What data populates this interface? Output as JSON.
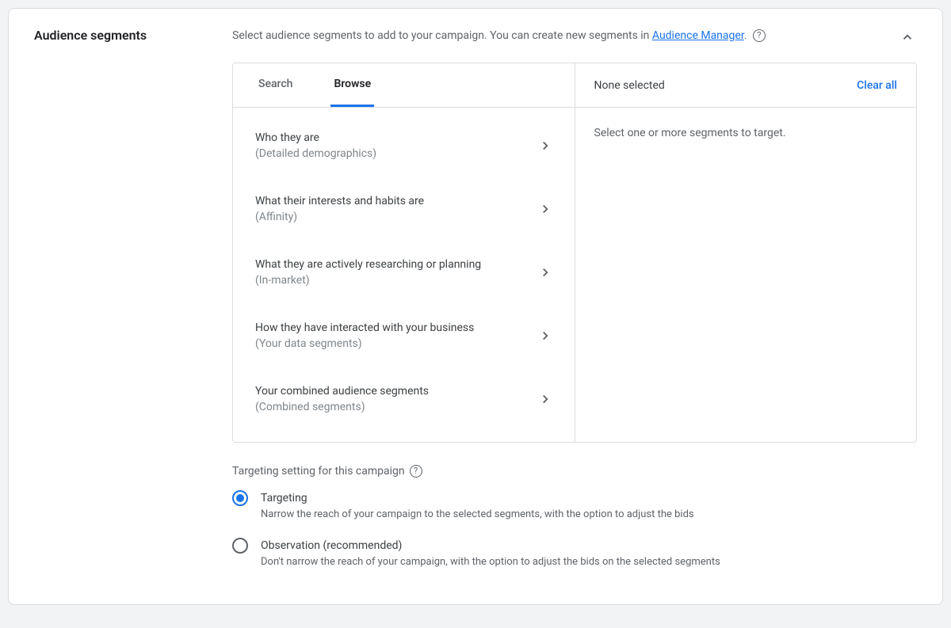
{
  "header": {
    "title": "Audience segments",
    "desc_prefix": "Select audience segments to add to your campaign. You can create new segments in ",
    "desc_link": "Audience Manager",
    "desc_suffix": "."
  },
  "tabs": {
    "search": "Search",
    "browse": "Browse"
  },
  "categories": [
    {
      "title": "Who they are",
      "subtitle": "(Detailed demographics)"
    },
    {
      "title": "What their interests and habits are",
      "subtitle": "(Affinity)"
    },
    {
      "title": "What they are actively researching or planning",
      "subtitle": "(In-market)"
    },
    {
      "title": "How they have interacted with your business",
      "subtitle": "(Your data segments)"
    },
    {
      "title": "Your combined audience segments",
      "subtitle": "(Combined segments)"
    }
  ],
  "right": {
    "title": "None selected",
    "clear": "Clear all",
    "empty": "Select one or more segments to target."
  },
  "targeting": {
    "heading": "Targeting setting for this campaign",
    "options": [
      {
        "title": "Targeting",
        "desc": "Narrow the reach of your campaign to the selected segments, with the option to adjust the bids",
        "selected": true
      },
      {
        "title": "Observation (recommended)",
        "desc": "Don't narrow the reach of your campaign, with the option to adjust the bids on the selected segments",
        "selected": false
      }
    ]
  }
}
